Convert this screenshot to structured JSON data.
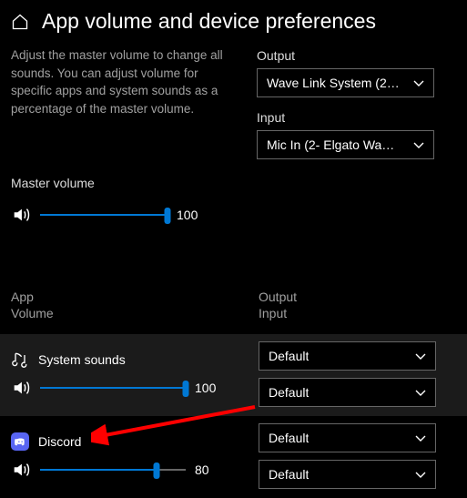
{
  "title": "App volume and device preferences",
  "description": "Adjust the master volume to change all sounds. You can adjust volume for specific apps and system sounds as a percentage of the master volume.",
  "output_label": "Output",
  "output_device": "Wave Link System (2…",
  "input_label": "Input",
  "input_device": "Mic In (2- Elgato Wa…",
  "master_label": "Master volume",
  "master_value": "100",
  "list_header_app": "App",
  "list_header_vol": "Volume",
  "list_header_output": "Output",
  "list_header_input": "Input",
  "apps": {
    "system": {
      "name": "System sounds",
      "volume": "100",
      "output": "Default",
      "input": "Default"
    },
    "discord": {
      "name": "Discord",
      "volume": "80",
      "output": "Default",
      "input": "Default"
    }
  }
}
